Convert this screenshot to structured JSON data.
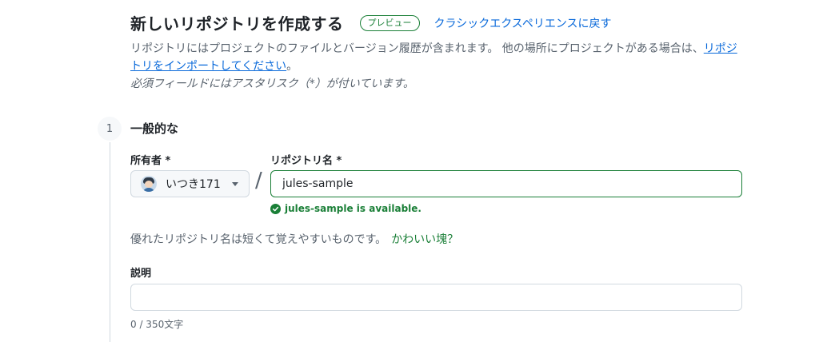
{
  "header": {
    "title": "新しいリポジトリを作成する",
    "preview_badge": "プレビュー",
    "classic_link": "クラシックエクスペリエンスに戻す"
  },
  "intro": {
    "text_before": "リポジトリにはプロジェクトのファイルとバージョン履歴が含まれます。 他の場所にプロジェクトがある場合は、",
    "import_link": "リポジトリをインポートしてください",
    "text_after": "。",
    "required_note": "必須フィールドにはアスタリスク（*）が付いています。"
  },
  "section": {
    "step_number": "1",
    "title": "一般的な"
  },
  "owner": {
    "label": "所有者 *",
    "value": "いつき171"
  },
  "repo_name": {
    "label": "リポジトリ名 *",
    "value": "jules-sample",
    "availability": "jules-sample is available."
  },
  "hint": {
    "text": "優れたリポジトリ名は短くて覚えやすいものです。",
    "suggestion": "かわいい塊？"
  },
  "description": {
    "label": "説明",
    "value": "",
    "char_count": "0 / 350文字"
  },
  "colors": {
    "accent_green": "#1a7f37",
    "link_blue": "#0969da",
    "muted_text": "#59636e",
    "border": "#d1d9e0"
  }
}
